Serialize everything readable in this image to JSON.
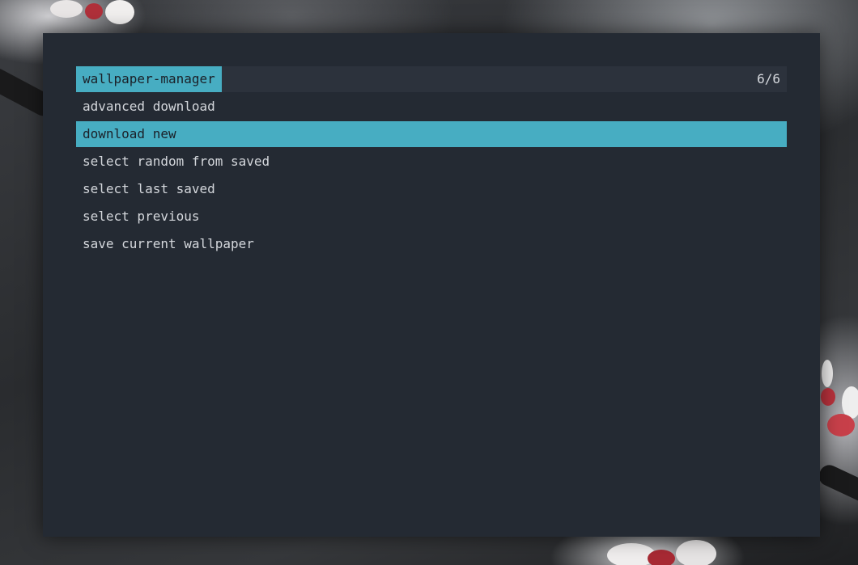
{
  "theme": {
    "background": "#242a33",
    "input_background": "#2c323c",
    "accent": "#47adc2",
    "text": "#d4d7dc",
    "selected_text": "#1b2028"
  },
  "launcher": {
    "prompt": "wallpaper-manager",
    "counter": "6/6",
    "items": [
      {
        "label": "advanced download",
        "selected": false
      },
      {
        "label": "download new",
        "selected": true
      },
      {
        "label": "select random from saved",
        "selected": false
      },
      {
        "label": "select last saved",
        "selected": false
      },
      {
        "label": "select previous",
        "selected": false
      },
      {
        "label": "save current wallpaper",
        "selected": false
      }
    ]
  }
}
